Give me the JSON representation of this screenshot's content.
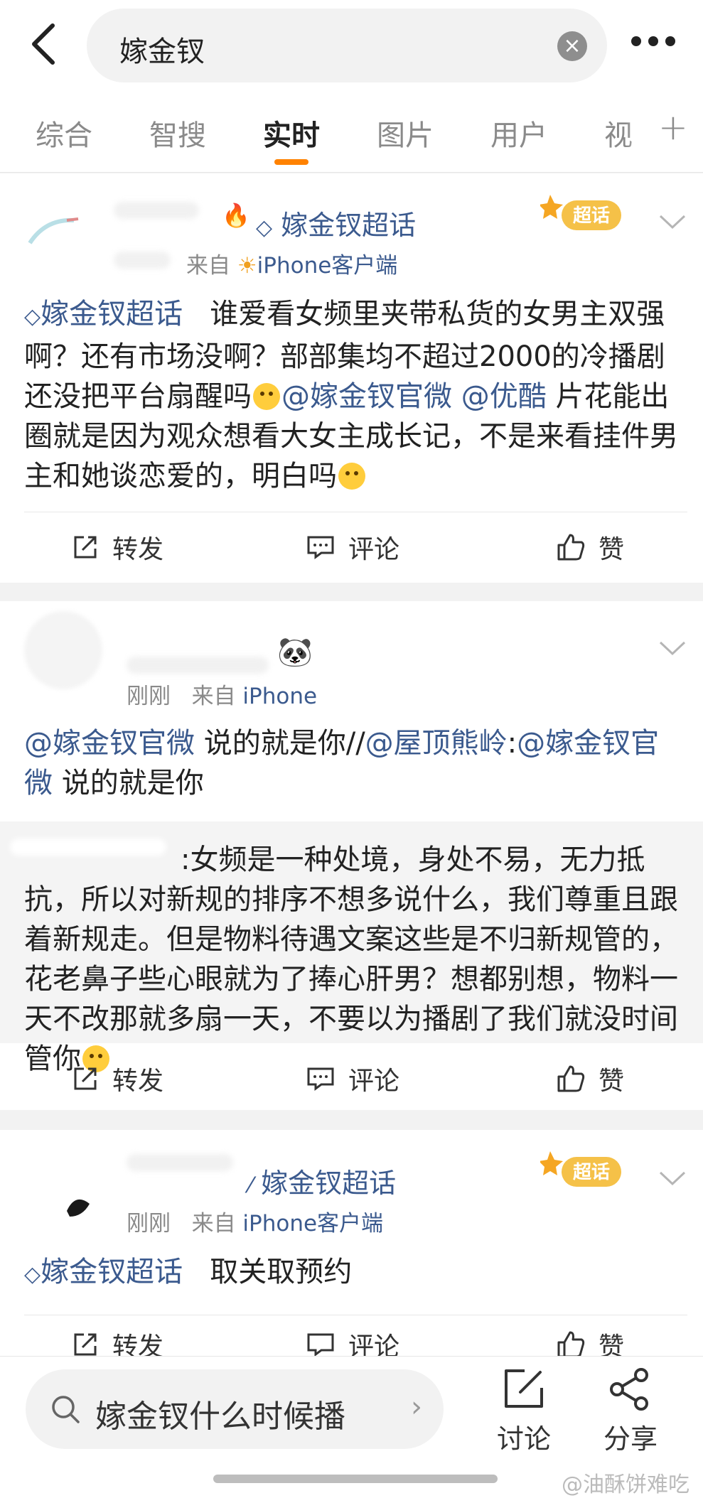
{
  "search": {
    "query": "嫁金钗"
  },
  "tabs": [
    "综合",
    "智搜",
    "实时",
    "图片",
    "用户",
    "视"
  ],
  "active_tab_index": 2,
  "actions": {
    "repost": "转发",
    "comment": "评论",
    "like": "赞"
  },
  "posts": [
    {
      "meta_from": "来自",
      "source": "iPhone客户端",
      "supertopic_tag": "嫁金钗超话",
      "badge": "超话",
      "body_tag": "嫁金钗超话",
      "body_text_1": "谁爱看女频里夹带私货的女男主双强啊？还有市场没啊？部部集均不超过2000的冷播剧还没把平台扇醒吗",
      "mention_1": "@嫁金钗官微",
      "mention_2": "@优酷",
      "body_text_2": "片花能出圈就是因为观众想看大女主成长记，不是来看挂件男主和她谈恋爱的，明白吗"
    },
    {
      "time": "刚刚",
      "meta_from": "来自",
      "source": "iPhone",
      "mention_1": "@嫁金钗官微",
      "text_1": "说的就是你//",
      "mention_2": "@屋顶熊岭",
      "sep": ":",
      "mention_3": "@嫁金钗官微",
      "text_2": "说的就是你",
      "repost_text": ":女频是一种处境，身处不易，无力抵抗，所以对新规的排序不想多说什么，我们尊重且跟着新规走。但是物料待遇文案这些是不归新规管的，花老鼻子些心眼就为了捧心肝男？想都别想，物料一天不改那就多扇一天，不要以为播剧了我们就没时间管你"
    },
    {
      "time": "刚刚",
      "meta_from": "来自",
      "source": "iPhone客户端",
      "supertopic_tag": "嫁金钗超话",
      "badge": "超话",
      "body_tag": "嫁金钗超话",
      "body_text": "取关取预约"
    }
  ],
  "bottom": {
    "search_text": "嫁金钗什么时候播",
    "discuss": "讨论",
    "share": "分享",
    "watermark": "@油酥饼难吃"
  },
  "colors": {
    "link": "#3b5a8e",
    "accent": "#ff8200",
    "badge": "#f5b53f"
  }
}
